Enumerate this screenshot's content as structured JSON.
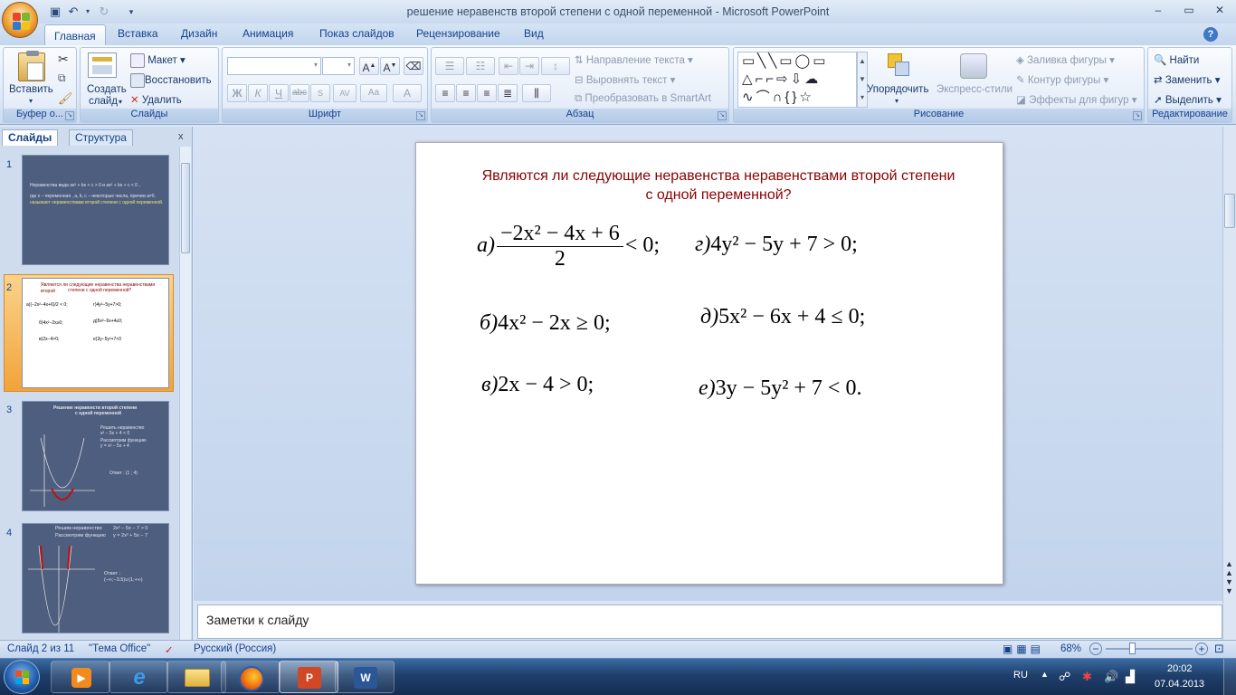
{
  "window": {
    "title": "решение неравенств второй степени с одной переменной - Microsoft PowerPoint"
  },
  "tabs": [
    "Главная",
    "Вставка",
    "Дизайн",
    "Анимация",
    "Показ слайдов",
    "Рецензирование",
    "Вид"
  ],
  "ribbon": {
    "clipboard": {
      "paste": "Вставить",
      "label": "Буфер о..."
    },
    "slides": {
      "new_slide": "Создать",
      "new_slide2": "слайд",
      "layout": "Макет",
      "reset": "Восстановить",
      "delete": "Удалить",
      "label": "Слайды"
    },
    "font": {
      "label": "Шрифт",
      "bold": "Ж",
      "italic": "К",
      "underline": "Ч",
      "strike": "abc",
      "spacing": "AV",
      "case": "Aa",
      "color": "A"
    },
    "paragraph": {
      "label": "Абзац",
      "text_direction": "Направление текста",
      "align_text": "Выровнять текст",
      "smartart": "Преобразовать в SmartArt"
    },
    "drawing": {
      "label": "Рисование",
      "arrange": "Упорядочить",
      "quick_styles": "Экспресс-стили",
      "fill": "Заливка фигуры",
      "outline": "Контур фигуры",
      "effects": "Эффекты для фигур"
    },
    "editing": {
      "label": "Редактирование",
      "find": "Найти",
      "replace": "Заменить",
      "select": "Выделить"
    }
  },
  "panel": {
    "tab_slides": "Слайды",
    "tab_outline": "Структура",
    "close": "x"
  },
  "thumbs": [
    {
      "num": "1",
      "line1": "Неравенства вида ax² + bx + c > 0  и  ax² + bx + c < 0 ,",
      "line2": "где x – переменная , a, b, c – некоторые числа, причем a≠0,",
      "line3": "называют неравенствами второй степени с одной переменной."
    },
    {
      "num": "2",
      "line1": "Являются ли следующие неравенства неравенствами второй",
      "line2": "степени с одной переменной?",
      "a": "а)(−2x²−4x+6)/2 < 0;",
      "g": "г)4y²−5y+7>0;",
      "b": "б)4x²−2x≥0;",
      "d": "д)5x²−6x+4≤0;",
      "v": "в)2x−4>0;",
      "e": "е)3y−5y²+7<0"
    },
    {
      "num": "3",
      "title": "Решение неравенств второй степени",
      "title2": "с одной переменной",
      "t1": "Решить неравенство",
      "t2": "x² − 5x + 4 < 0",
      "t3": "Рассмотрим функцию",
      "t4": "y = x² − 5x + 4",
      "answer": "Ответ : (1 ; 4)"
    },
    {
      "num": "4",
      "t1": "Решим неравенство",
      "t1b": "2x² − 5x − 7 > 0",
      "t2": "Рассмотрим функцию",
      "t2b": "y = 2x² + 5x − 7",
      "answer": "Ответ :",
      "answer2": "(−∞;−3.5)∪(1;+∞)"
    }
  ],
  "slide": {
    "title": "Являются ли следующие неравенства неравенствами второй степени с одной переменной?",
    "a_label": "а)",
    "a_num": "−2x² − 4x + 6",
    "a_den": "2",
    "a_rel": "< 0;",
    "g_label": "г)",
    "g_expr": "4y² − 5y + 7 > 0;",
    "b_label": "б)",
    "b_expr": "4x² − 2x ≥ 0;",
    "d_label": "д)",
    "d_expr": "5x² − 6x + 4 ≤ 0;",
    "v_label": "в)",
    "v_expr": "2x − 4 > 0;",
    "e_label": "е)",
    "e_expr": "3y − 5y² + 7 < 0."
  },
  "notes": {
    "placeholder": "Заметки к слайду"
  },
  "status": {
    "slide": "Слайд 2 из 11",
    "theme": "\"Тема Office\"",
    "language": "Русский (Россия)",
    "zoom": "68%"
  },
  "taskbar": {
    "lang": "RU",
    "time": "20:02",
    "date": "07.04.2013"
  }
}
